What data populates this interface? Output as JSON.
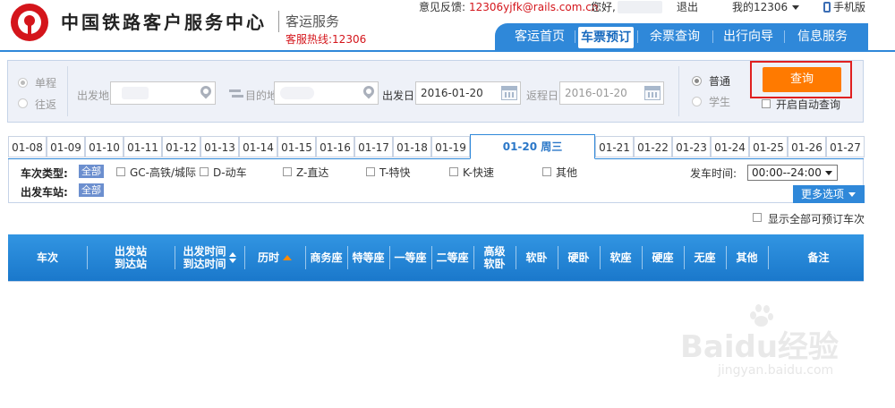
{
  "header": {
    "brand": "中国铁路客户服务中心",
    "subtitle": "客运服务",
    "hotline": "客服热线:12306"
  },
  "topbar": {
    "feedback_label": "意见反馈:",
    "feedback_email": "12306yjfk@rails.com.cn",
    "hello": "您好,",
    "exit": "退出",
    "my": "我的12306",
    "mobile": "手机版"
  },
  "nav": {
    "items": [
      "客运首页",
      "车票预订",
      "余票查询",
      "出行向导",
      "信息服务"
    ],
    "active": "车票预订"
  },
  "search": {
    "trip_type": {
      "one_way": "单程",
      "round_trip": "往返",
      "selected": "单程"
    },
    "from_label": "出发地",
    "to_label": "目的地",
    "depart_date_label": "出发日",
    "depart_date": "2016-01-20",
    "return_date_label": "返程日",
    "return_date": "2016-01-20",
    "ticket_type": {
      "normal": "普通",
      "student": "学生",
      "selected": "普通"
    },
    "query_button": "查询",
    "auto_query": "开启自动查询"
  },
  "date_tabs": [
    "01-08",
    "01-09",
    "01-10",
    "01-11",
    "01-12",
    "01-13",
    "01-14",
    "01-15",
    "01-16",
    "01-17",
    "01-18",
    "01-19",
    "01-20 周三",
    "01-21",
    "01-22",
    "01-23",
    "01-24",
    "01-25",
    "01-26",
    "01-27"
  ],
  "active_date": "01-20 周三",
  "filters": {
    "train_type_label": "车次类型:",
    "all": "全部",
    "train_types": [
      "GC-高铁/城际",
      "D-动车",
      "Z-直达",
      "T-特快",
      "K-快速",
      "其他"
    ],
    "station_label": "出发车站:",
    "depart_time_label": "发车时间:",
    "depart_time_value": "00:00--24:00",
    "more_options": "更多选项",
    "show_all": "显示全部可预订车次"
  },
  "table": {
    "columns": [
      {
        "key": "train",
        "lines": [
          "车次"
        ]
      },
      {
        "key": "stations",
        "lines": [
          "出发站",
          "到达站"
        ]
      },
      {
        "key": "times",
        "lines": [
          "出发时间",
          "到达时间"
        ]
      },
      {
        "key": "duration",
        "lines": [
          "历时"
        ]
      },
      {
        "key": "business",
        "lines": [
          "商务座"
        ]
      },
      {
        "key": "premium",
        "lines": [
          "特等座"
        ]
      },
      {
        "key": "first",
        "lines": [
          "一等座"
        ]
      },
      {
        "key": "second",
        "lines": [
          "二等座"
        ]
      },
      {
        "key": "deluxe_soft_sleeper",
        "lines": [
          "高级",
          "软卧"
        ]
      },
      {
        "key": "soft_sleeper",
        "lines": [
          "软卧"
        ]
      },
      {
        "key": "hard_sleeper",
        "lines": [
          "硬卧"
        ]
      },
      {
        "key": "soft_seat",
        "lines": [
          "软座"
        ]
      },
      {
        "key": "hard_seat",
        "lines": [
          "硬座"
        ]
      },
      {
        "key": "standing",
        "lines": [
          "无座"
        ]
      },
      {
        "key": "other",
        "lines": [
          "其他"
        ]
      },
      {
        "key": "note",
        "lines": [
          "备注"
        ]
      }
    ]
  },
  "watermark": {
    "text": "Baidu经验",
    "url": "jingyan.baidu.com"
  },
  "colors": {
    "brand_blue": "#2f88d9",
    "accent_orange": "#ff7a00",
    "brand_red": "#d4151b"
  }
}
